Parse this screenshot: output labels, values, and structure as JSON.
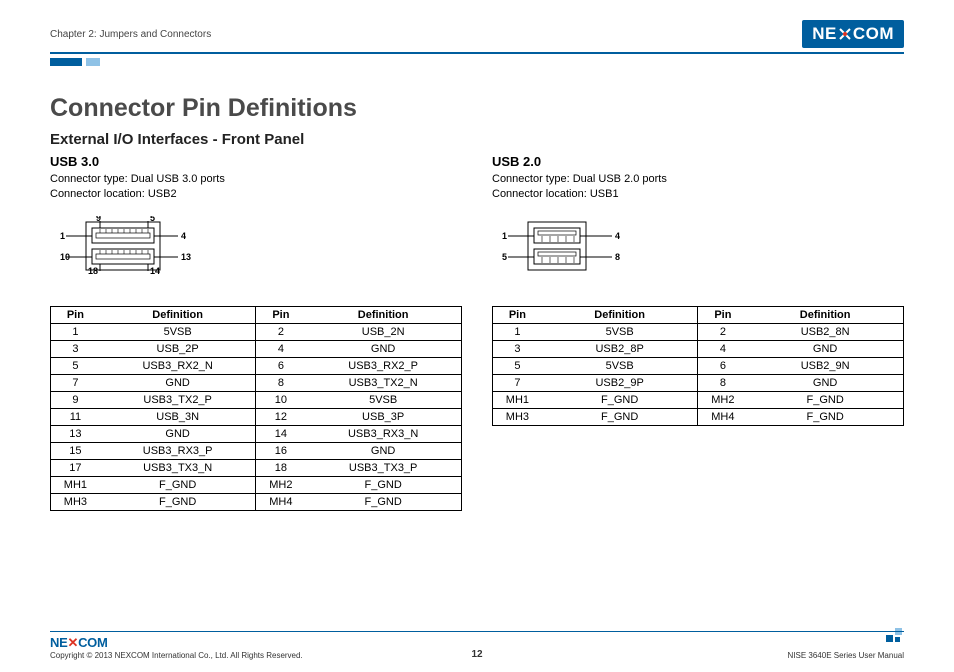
{
  "header": {
    "chapter": "Chapter 2: Jumpers and Connectors",
    "brand_pre": "NE",
    "brand_post": "COM"
  },
  "title": "Connector Pin Definitions",
  "subtitle": "External I/O Interfaces - Front Panel",
  "left": {
    "heading": "USB 3.0",
    "line1": "Connector type: Dual USB 3.0 ports",
    "line2": "Connector location: USB2",
    "diag": {
      "p1": "1",
      "p4": "4",
      "p5": "5",
      "p9": "9",
      "p10": "10",
      "p13": "13",
      "p14": "14",
      "p18": "18"
    },
    "th_pin": "Pin",
    "th_def": "Definition",
    "rows": [
      {
        "a": "1",
        "b": "5VSB",
        "c": "2",
        "d": "USB_2N"
      },
      {
        "a": "3",
        "b": "USB_2P",
        "c": "4",
        "d": "GND"
      },
      {
        "a": "5",
        "b": "USB3_RX2_N",
        "c": "6",
        "d": "USB3_RX2_P"
      },
      {
        "a": "7",
        "b": "GND",
        "c": "8",
        "d": "USB3_TX2_N"
      },
      {
        "a": "9",
        "b": "USB3_TX2_P",
        "c": "10",
        "d": "5VSB"
      },
      {
        "a": "11",
        "b": "USB_3N",
        "c": "12",
        "d": "USB_3P"
      },
      {
        "a": "13",
        "b": "GND",
        "c": "14",
        "d": "USB3_RX3_N"
      },
      {
        "a": "15",
        "b": "USB3_RX3_P",
        "c": "16",
        "d": "GND"
      },
      {
        "a": "17",
        "b": "USB3_TX3_N",
        "c": "18",
        "d": "USB3_TX3_P"
      },
      {
        "a": "MH1",
        "b": "F_GND",
        "c": "MH2",
        "d": "F_GND"
      },
      {
        "a": "MH3",
        "b": "F_GND",
        "c": "MH4",
        "d": "F_GND"
      }
    ]
  },
  "right": {
    "heading": "USB 2.0",
    "line1": "Connector type: Dual USB 2.0 ports",
    "line2": "Connector location: USB1",
    "diag": {
      "p1": "1",
      "p4": "4",
      "p5": "5",
      "p8": "8"
    },
    "th_pin": "Pin",
    "th_def": "Definition",
    "rows": [
      {
        "a": "1",
        "b": "5VSB",
        "c": "2",
        "d": "USB2_8N"
      },
      {
        "a": "3",
        "b": "USB2_8P",
        "c": "4",
        "d": "GND"
      },
      {
        "a": "5",
        "b": "5VSB",
        "c": "6",
        "d": "USB2_9N"
      },
      {
        "a": "7",
        "b": "USB2_9P",
        "c": "8",
        "d": "GND"
      },
      {
        "a": "MH1",
        "b": "F_GND",
        "c": "MH2",
        "d": "F_GND"
      },
      {
        "a": "MH3",
        "b": "F_GND",
        "c": "MH4",
        "d": "F_GND"
      }
    ]
  },
  "footer": {
    "brand": "NE COM",
    "copyright": "Copyright © 2013 NEXCOM International Co., Ltd. All Rights Reserved.",
    "page": "12",
    "manual": "NISE 3640E Series User Manual"
  }
}
